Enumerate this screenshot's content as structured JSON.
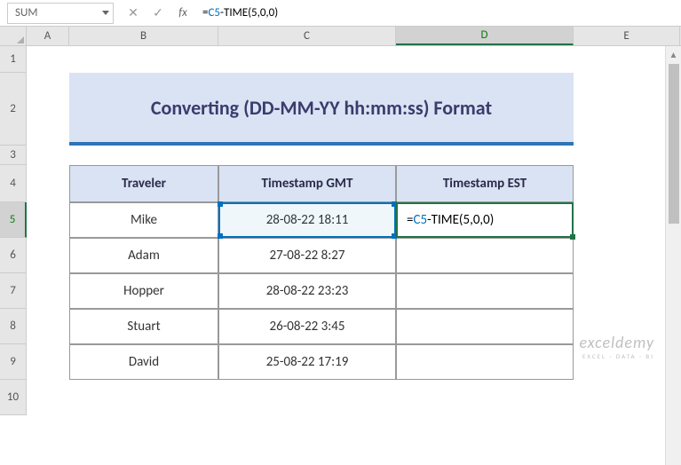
{
  "nameBox": "SUM",
  "formulaBar": {
    "prefix": "=",
    "ref": "C5",
    "suffix": "-TIME(5,0,0)"
  },
  "columns": [
    "A",
    "B",
    "C",
    "D",
    "E"
  ],
  "activeColumn": "D",
  "rows": [
    "1",
    "2",
    "3",
    "4",
    "5",
    "6",
    "7",
    "8",
    "9",
    "10"
  ],
  "activeRow": "5",
  "title": "Converting (DD-MM-YY hh:mm:ss) Format",
  "table": {
    "headers": [
      "Traveler",
      "Timestamp GMT",
      "Timestamp EST"
    ],
    "rows": [
      [
        "Mike",
        "28-08-22 18:11",
        ""
      ],
      [
        "Adam",
        "27-08-22 8:27",
        ""
      ],
      [
        "Hopper",
        "28-08-22 23:23",
        ""
      ],
      [
        "Stuart",
        "26-08-22 3:45",
        ""
      ],
      [
        "David",
        "25-08-22 17:19",
        ""
      ]
    ]
  },
  "activeCell": {
    "prefix": "=",
    "ref": "C5",
    "suffix": "-TIME(5,0,0)"
  },
  "watermark": {
    "main": "exceldemy",
    "sub": "EXCEL · DATA · BI"
  }
}
